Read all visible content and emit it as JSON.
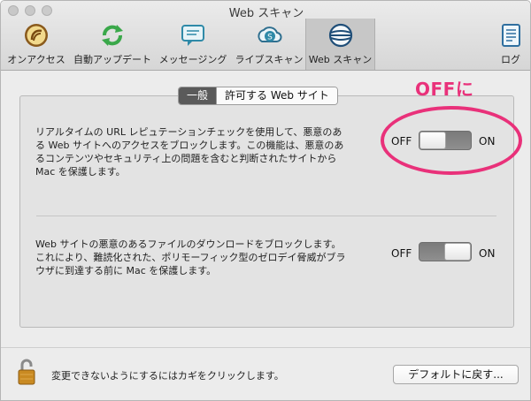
{
  "window": {
    "title": "Web スキャン"
  },
  "toolbar": {
    "items": [
      {
        "label": "オンアクセス",
        "icon": "on-access-icon"
      },
      {
        "label": "自動アップデート",
        "icon": "auto-update-icon"
      },
      {
        "label": "メッセージング",
        "icon": "messaging-icon"
      },
      {
        "label": "ライブスキャン",
        "icon": "live-scan-icon"
      },
      {
        "label": "Web スキャン",
        "icon": "web-scan-icon",
        "active": true
      },
      {
        "label": "ログ",
        "icon": "log-icon"
      }
    ]
  },
  "tabs": [
    {
      "label": "一般",
      "selected": true
    },
    {
      "label": "許可する Web サイト",
      "selected": false
    }
  ],
  "settings": [
    {
      "description": "リアルタイムの URL レピュテーションチェックを使用して、悪意のある Web サイトへのアクセスをブロックします。この機能は、悪意のあるコンテンツやセキュリティ上の問題を含むと判断されたサイトから Mac を保護します。",
      "off_label": "OFF",
      "on_label": "ON",
      "state": "off"
    },
    {
      "description": "Web サイトの悪意のあるファイルのダウンロードをブロックします。これにより、難読化された、ポリモーフィック型のゼロデイ脅威がブラウザに到達する前に Mac を保護します。",
      "off_label": "OFF",
      "on_label": "ON",
      "state": "on"
    }
  ],
  "annotation": {
    "text": "OFFに",
    "color": "#e9317a"
  },
  "footer": {
    "lock_text": "変更できないようにするにはカギをクリックします。",
    "defaults_button": "デフォルトに戻す..."
  }
}
